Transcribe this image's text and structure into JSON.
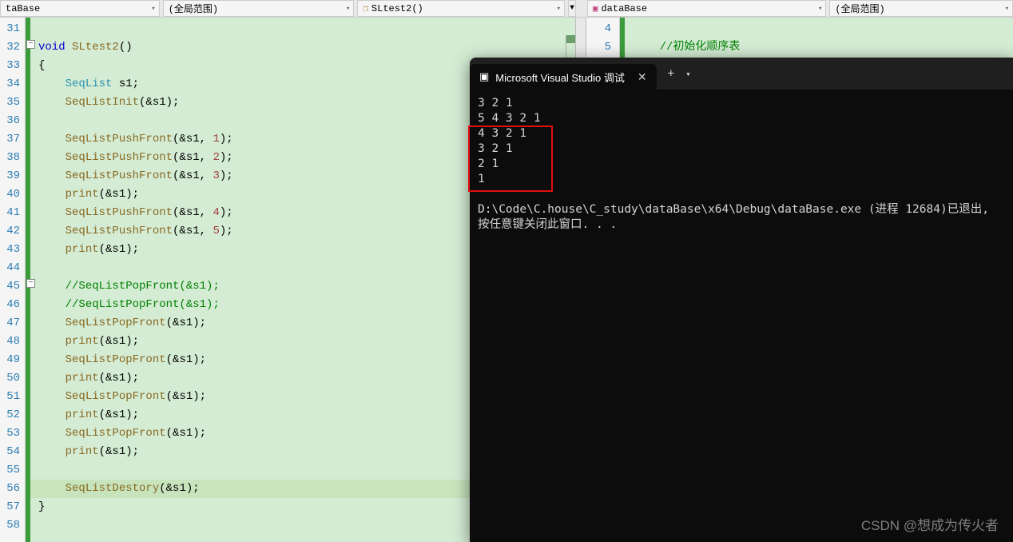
{
  "toolbar": {
    "dd1": "taBase",
    "dd2": "(全局范围)",
    "dd3": "SLtest2()",
    "dd5": "dataBase",
    "dd6": "(全局范围)"
  },
  "left_editor": {
    "line_numbers": [
      "31",
      "32",
      "33",
      "34",
      "35",
      "36",
      "37",
      "38",
      "39",
      "40",
      "41",
      "42",
      "43",
      "44",
      "45",
      "46",
      "47",
      "48",
      "49",
      "50",
      "51",
      "52",
      "53",
      "54",
      "55",
      "56",
      "57",
      "58"
    ],
    "code": [
      {
        "indent": 0,
        "tokens": []
      },
      {
        "indent": 0,
        "tokens": [
          {
            "t": "kw",
            "v": "void"
          },
          {
            "t": "",
            "v": " "
          },
          {
            "t": "func",
            "v": "SLtest2"
          },
          {
            "t": "",
            "v": "()"
          }
        ]
      },
      {
        "indent": 0,
        "tokens": [
          {
            "t": "",
            "v": "{"
          }
        ]
      },
      {
        "indent": 1,
        "tokens": [
          {
            "t": "type",
            "v": "SeqList"
          },
          {
            "t": "",
            "v": " s1;"
          }
        ]
      },
      {
        "indent": 1,
        "tokens": [
          {
            "t": "func",
            "v": "SeqListInit"
          },
          {
            "t": "",
            "v": "(&s1);"
          }
        ]
      },
      {
        "indent": 1,
        "tokens": []
      },
      {
        "indent": 1,
        "tokens": [
          {
            "t": "func",
            "v": "SeqListPushFront"
          },
          {
            "t": "",
            "v": "(&s1, "
          },
          {
            "t": "num",
            "v": "1"
          },
          {
            "t": "",
            "v": ");"
          }
        ]
      },
      {
        "indent": 1,
        "tokens": [
          {
            "t": "func",
            "v": "SeqListPushFront"
          },
          {
            "t": "",
            "v": "(&s1, "
          },
          {
            "t": "num",
            "v": "2"
          },
          {
            "t": "",
            "v": ");"
          }
        ]
      },
      {
        "indent": 1,
        "tokens": [
          {
            "t": "func",
            "v": "SeqListPushFront"
          },
          {
            "t": "",
            "v": "(&s1, "
          },
          {
            "t": "num",
            "v": "3"
          },
          {
            "t": "",
            "v": ");"
          }
        ]
      },
      {
        "indent": 1,
        "tokens": [
          {
            "t": "func",
            "v": "print"
          },
          {
            "t": "",
            "v": "(&s1);"
          }
        ]
      },
      {
        "indent": 1,
        "tokens": [
          {
            "t": "func",
            "v": "SeqListPushFront"
          },
          {
            "t": "",
            "v": "(&s1, "
          },
          {
            "t": "num",
            "v": "4"
          },
          {
            "t": "",
            "v": ");"
          }
        ]
      },
      {
        "indent": 1,
        "tokens": [
          {
            "t": "func",
            "v": "SeqListPushFront"
          },
          {
            "t": "",
            "v": "(&s1, "
          },
          {
            "t": "num",
            "v": "5"
          },
          {
            "t": "",
            "v": ");"
          }
        ]
      },
      {
        "indent": 1,
        "tokens": [
          {
            "t": "func",
            "v": "print"
          },
          {
            "t": "",
            "v": "(&s1);"
          }
        ]
      },
      {
        "indent": 1,
        "tokens": []
      },
      {
        "indent": 1,
        "tokens": [
          {
            "t": "comment",
            "v": "//SeqListPopFront(&s1);"
          }
        ]
      },
      {
        "indent": 1,
        "tokens": [
          {
            "t": "comment",
            "v": "//SeqListPopFront(&s1);"
          }
        ]
      },
      {
        "indent": 1,
        "tokens": [
          {
            "t": "func",
            "v": "SeqListPopFront"
          },
          {
            "t": "",
            "v": "(&s1);"
          }
        ]
      },
      {
        "indent": 1,
        "tokens": [
          {
            "t": "func",
            "v": "print"
          },
          {
            "t": "",
            "v": "(&s1);"
          }
        ]
      },
      {
        "indent": 1,
        "tokens": [
          {
            "t": "func",
            "v": "SeqListPopFront"
          },
          {
            "t": "",
            "v": "(&s1);"
          }
        ]
      },
      {
        "indent": 1,
        "tokens": [
          {
            "t": "func",
            "v": "print"
          },
          {
            "t": "",
            "v": "(&s1);"
          }
        ]
      },
      {
        "indent": 1,
        "tokens": [
          {
            "t": "func",
            "v": "SeqListPopFront"
          },
          {
            "t": "",
            "v": "(&s1);"
          }
        ]
      },
      {
        "indent": 1,
        "tokens": [
          {
            "t": "func",
            "v": "print"
          },
          {
            "t": "",
            "v": "(&s1);"
          }
        ]
      },
      {
        "indent": 1,
        "tokens": [
          {
            "t": "func",
            "v": "SeqListPopFront"
          },
          {
            "t": "",
            "v": "(&s1);"
          }
        ]
      },
      {
        "indent": 1,
        "tokens": [
          {
            "t": "func",
            "v": "print"
          },
          {
            "t": "",
            "v": "(&s1);"
          }
        ]
      },
      {
        "indent": 1,
        "tokens": []
      },
      {
        "indent": 1,
        "highlight": true,
        "tokens": [
          {
            "t": "func",
            "v": "SeqListDestory"
          },
          {
            "t": "",
            "v": "(&s1);"
          }
        ]
      },
      {
        "indent": 0,
        "tokens": [
          {
            "t": "",
            "v": "}"
          }
        ]
      },
      {
        "indent": 0,
        "tokens": []
      }
    ]
  },
  "right_editor": {
    "line_numbers": [
      "4",
      "5"
    ],
    "lines": [
      {
        "tokens": []
      },
      {
        "tokens": [
          {
            "t": "comment",
            "v": "//初始化顺序表"
          }
        ]
      }
    ]
  },
  "terminal": {
    "tab_title": "Microsoft Visual Studio 调试",
    "output": [
      "3 2 1",
      "5 4 3 2 1",
      "4 3 2 1",
      "3 2 1",
      "2 1",
      "1",
      "",
      "D:\\Code\\C.house\\C_study\\dataBase\\x64\\Debug\\dataBase.exe (进程 12684)已退出,",
      "按任意键关闭此窗口. . ."
    ]
  },
  "watermark": "CSDN @想成为传火者"
}
